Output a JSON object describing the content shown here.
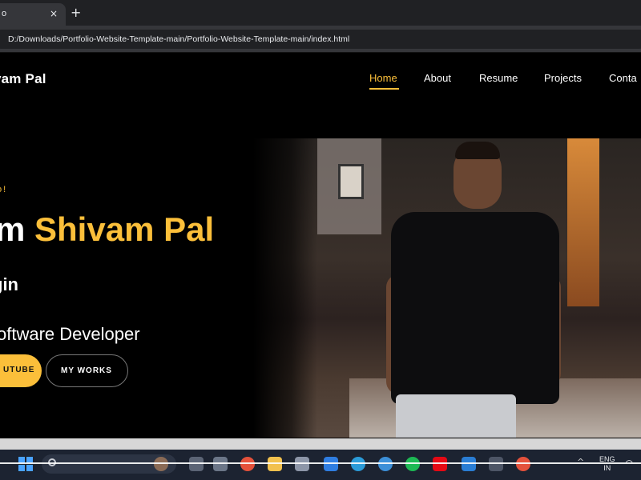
{
  "browser": {
    "tab_title": "o",
    "tab_close": "×",
    "new_tab": "+",
    "url": "D:/Downloads/Portfolio-Website-Template-main/Portfolio-Website-Template-main/index.html"
  },
  "site": {
    "logo": "vam Pal",
    "nav": [
      {
        "label": "Home",
        "active": true
      },
      {
        "label": "About",
        "active": false
      },
      {
        "label": "Resume",
        "active": false
      },
      {
        "label": "Projects",
        "active": false
      },
      {
        "label": "Conta",
        "active": false
      }
    ],
    "accent_color": "#fbbf3a",
    "hero": {
      "greeting": "o!",
      "name_prefix": "m ",
      "name_main": "Shivam Pal",
      "subtitle_1": "gin",
      "subtitle_2": "oftware Developer",
      "primary_button": "UTUBE",
      "secondary_button": "MY WORKS"
    }
  },
  "taskbar": {
    "search_placeholder": "",
    "language": "ENG",
    "region": "IN",
    "tray_chevron": "^",
    "icons": [
      "start-icon",
      "search-icon",
      "avatar-icon",
      "task-view-icon",
      "widgets-icon",
      "chrome-icon",
      "file-explorer-icon",
      "store-icon",
      "outlook-icon",
      "edge-icon",
      "browser-icon",
      "spotify-icon",
      "netflix-icon",
      "vscode-icon",
      "notepad-icon",
      "chrome-icon-2"
    ]
  }
}
